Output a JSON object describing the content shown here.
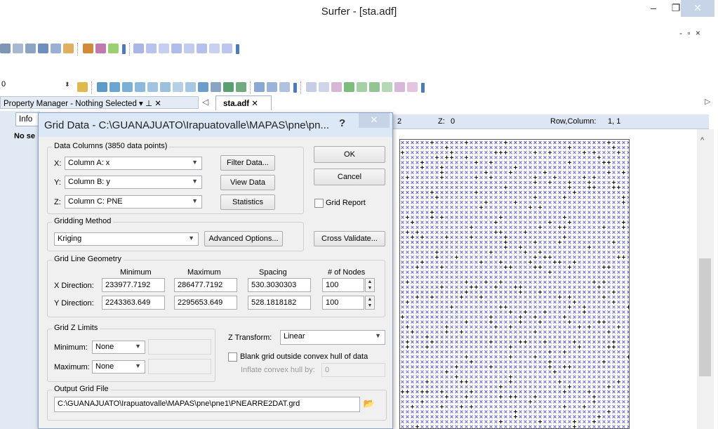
{
  "window": {
    "title": "Surfer - [sta.adf]",
    "min_glyph": "–",
    "max_glyph": "❐",
    "close_glyph": "✕",
    "mdi_controls": "- ▫ ×"
  },
  "toolbar2": {
    "value": "0",
    "spin_glyph": "⬍"
  },
  "property_manager": {
    "header": "Property Manager - Nothing Selected  ▾ ⊥ ✕",
    "info_tab": "Info",
    "no_selection": "No se"
  },
  "document": {
    "nav_left": "◁",
    "tab_label": "sta.adf  ✕",
    "nav_right": "▷"
  },
  "status": {
    "left_fragment": "2",
    "z_label": "Z:",
    "z_value": "0",
    "rowcol_label": "Row,Column:",
    "rowcol_value": "1, 1"
  },
  "scroll": {
    "up_glyph": "^"
  },
  "dialog": {
    "title": "Grid Data - C:\\GUANAJUATO\\Irapuatovalle\\MAPAS\\pne\\pn...",
    "help": "?",
    "close_glyph": "✕",
    "data_columns": {
      "label": "Data Columns   (3850 data points)",
      "x_label": "X:",
      "x_value": "Column A:  x",
      "y_label": "Y:",
      "y_value": "Column B:  y",
      "z_label": "Z:",
      "z_value": "Column C:  PNE"
    },
    "buttons": {
      "filter": "Filter Data...",
      "view": "View Data",
      "statistics": "Statistics",
      "ok": "OK",
      "cancel": "Cancel",
      "advanced": "Advanced Options...",
      "cross_validate": "Cross Validate..."
    },
    "grid_report": "Grid Report",
    "gridding": {
      "label": "Gridding Method",
      "value": "Kriging"
    },
    "geometry": {
      "label": "Grid Line Geometry",
      "col_min": "Minimum",
      "col_max": "Maximum",
      "col_spacing": "Spacing",
      "col_nodes": "# of Nodes",
      "x_label": "X Direction:",
      "x_min": "233977.7192",
      "x_max": "286477.7192",
      "x_spacing": "530.3030303",
      "x_nodes": "100",
      "y_label": "Y Direction:",
      "y_min": "2243363.649",
      "y_max": "2295653.649",
      "y_spacing": "528.1818182",
      "y_nodes": "100"
    },
    "z_limits": {
      "label": "Grid Z Limits",
      "min_label": "Minimum:",
      "min_value": "None",
      "max_label": "Maximum:",
      "max_value": "None"
    },
    "transform": {
      "label": "Z Transform:",
      "value": "Linear"
    },
    "blank_hull": "Blank grid outside convex hull of data",
    "inflate": {
      "label": "Inflate convex hull by:",
      "value": "0"
    },
    "output": {
      "label": "Output Grid File",
      "path": "C:\\GUANAJUATO\\Irapuatovalle\\MAPAS\\pne\\pne1\\PNEARRE2DAT.grd"
    }
  },
  "colors": {
    "accent": "#dce8f6",
    "panel": "#e1e9f4",
    "grid_x": "#5b5bd6",
    "grid_plus": "#1a1a1a",
    "toolbar_grip": "#4d7ab8"
  }
}
